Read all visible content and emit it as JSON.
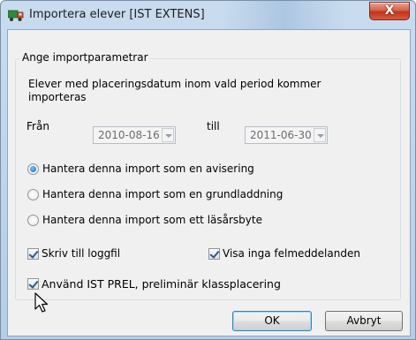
{
  "window": {
    "title": "Importera elever [IST EXTENS]",
    "icon": "truck-app-icon",
    "close_symbol": "X"
  },
  "group": {
    "legend": "Ange importparametrar",
    "description": "Elever med placeringsdatum inom vald period kommer importeras"
  },
  "dates": {
    "from_label": "Från",
    "from_value": "2010-08-16",
    "to_label": "till",
    "to_value": "2011-06-30"
  },
  "radios": [
    {
      "label": "Hantera denna import som en avisering",
      "checked": true
    },
    {
      "label": "Hantera denna import som en grundladdning",
      "checked": false
    },
    {
      "label": "Hantera denna import som ett läsårsbyte",
      "checked": false
    }
  ],
  "checkboxes": {
    "log": {
      "label": "Skriv till loggfil",
      "checked": true
    },
    "no_errors": {
      "label": "Visa inga felmeddelanden",
      "checked": true
    },
    "prel": {
      "label": "Använd IST PREL, preliminär klassplacering",
      "checked": true
    }
  },
  "buttons": {
    "ok": "OK",
    "cancel": "Avbryt"
  },
  "colors": {
    "title_bar": "#c9dcef",
    "close_button": "#c0361d",
    "dialog_face": "#f0f0f0",
    "default_button_border": "#3c7fb1"
  }
}
